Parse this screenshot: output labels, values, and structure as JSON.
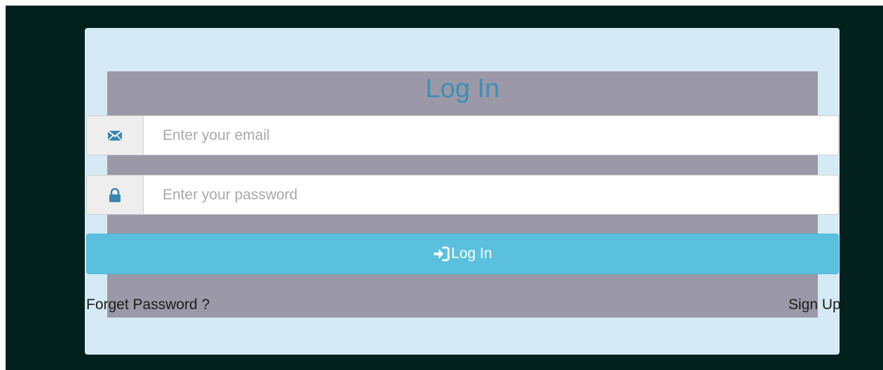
{
  "form": {
    "title": "Log In",
    "email": {
      "placeholder": "Enter your email",
      "icon": "envelope-icon"
    },
    "password": {
      "placeholder": "Enter your password",
      "icon": "lock-icon"
    },
    "submit": {
      "label": "Log In",
      "icon": "log-in-icon"
    },
    "forget_password_label": "Forget Password ?",
    "sign_up_label": "Sign Up"
  },
  "colors": {
    "page_background": "#02201e",
    "card_background": "#d6eaf5",
    "panel_background": "#9b99a7",
    "title_color": "#3d8fb8",
    "button_background": "#5bc0de",
    "icon_color": "#3a87ad"
  }
}
